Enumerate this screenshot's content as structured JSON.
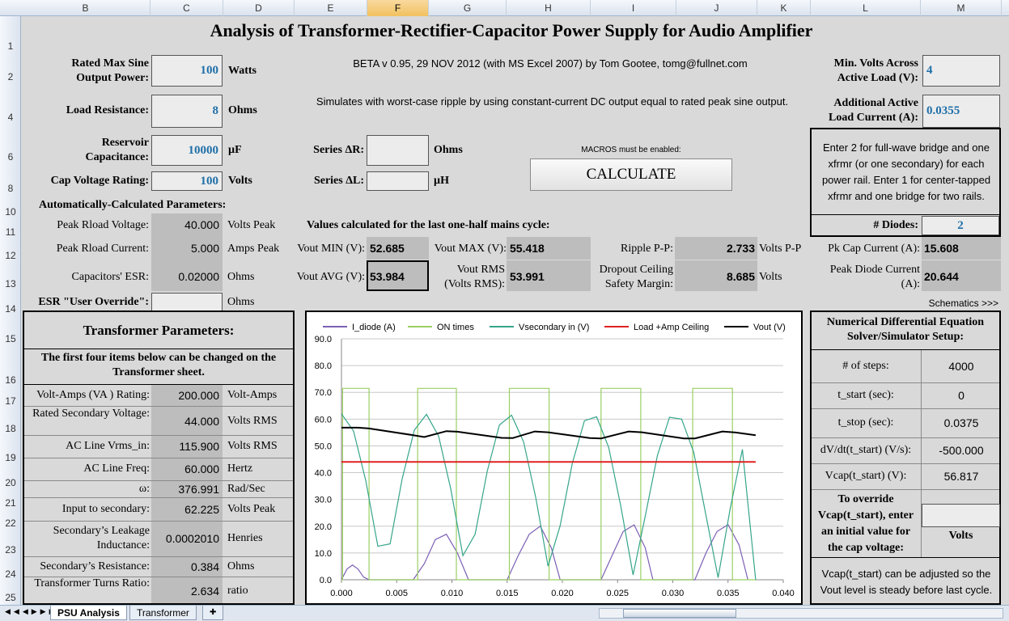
{
  "columns": [
    "B",
    "C",
    "D",
    "E",
    "F",
    "G",
    "H",
    "I",
    "J",
    "K",
    "L",
    "M"
  ],
  "selected_column": "F",
  "rows": [
    "1",
    "2",
    "4",
    "6",
    "8",
    "10",
    "11",
    "12",
    "13",
    "14",
    "15",
    "16",
    "17",
    "18",
    "19",
    "20",
    "21",
    "22",
    "23",
    "24",
    "25"
  ],
  "title": "Analysis of Transformer-Rectifier-Capacitor Power Supply for Audio Amplifier",
  "subtitle_beta": "BETA v 0.95, 29 NOV 2012 (with MS Excel 2007) by Tom Gootee, tomg@fullnet.com",
  "subtitle_sim": "Simulates with worst-case ripple by using constant-current DC output equal to rated peak sine output.",
  "inputs": {
    "rated_power": {
      "label1": "Rated Max Sine",
      "label2": "Output Power:",
      "value": "100",
      "unit": "Watts"
    },
    "load_res": {
      "label": "Load Resistance:",
      "value": "8",
      "unit": "Ohms"
    },
    "reservoir": {
      "label1": "Reservoir",
      "label2": "Capacitance:",
      "value": "10000",
      "unit": "µF"
    },
    "cap_rating": {
      "label": "Cap Voltage Rating:",
      "value": "100",
      "unit": "Volts"
    },
    "series_r": {
      "label": "Series ΔR:",
      "value": "",
      "unit": "Ohms"
    },
    "series_l": {
      "label": "Series ΔL:",
      "value": "",
      "unit": "µH"
    },
    "min_volts": {
      "label1": "Min. Volts Across",
      "label2": "Active Load (V):",
      "value": "4"
    },
    "add_current": {
      "label1": "Additional Active",
      "label2": "Load Current  (A):",
      "value": "0.0355"
    },
    "esr_override": {
      "label": "ESR \"User Override\":",
      "value": "",
      "unit": "Ohms"
    }
  },
  "macros_note": "MACROS must be enabled:",
  "calculate_label": "CALCULATE",
  "info_text": "Enter 2 for full-wave bridge and one xfrmr (or one secondary) for each power rail. Enter 1 for center-tapped xfrmr and one bridge for two rails.",
  "diodes": {
    "label": "# Diodes:",
    "value": "2"
  },
  "auto_params": {
    "heading": "Automatically-Calculated Parameters:",
    "peak_v": {
      "label": "Peak Rload Voltage:",
      "value": "40.000",
      "unit": "Volts Peak"
    },
    "peak_i": {
      "label": "Peak Rload Current:",
      "value": "5.000",
      "unit": "Amps Peak"
    },
    "esr": {
      "label": "Capacitors' ESR:",
      "value": "0.02000",
      "unit": "Ohms"
    }
  },
  "last_cycle": {
    "heading": "Values calculated for the last one-half mains cycle:",
    "vout_min": {
      "label": "Vout MIN (V):",
      "value": "52.685"
    },
    "vout_max": {
      "label": "Vout MAX (V):",
      "value": "55.418"
    },
    "ripple": {
      "label": "Ripple P-P:",
      "value": "2.733",
      "unit": "Volts P-P"
    },
    "vout_avg": {
      "label": "Vout AVG (V):",
      "value": "53.984"
    },
    "vout_rms": {
      "label1": "Vout RMS",
      "label2": "(Volts RMS):",
      "value": "53.991"
    },
    "dropout": {
      "label1": "Dropout Ceiling",
      "label2": "Safety Margin:",
      "value": "8.685",
      "unit": "Volts"
    },
    "pk_cap": {
      "label": "Pk Cap Current (A):",
      "value": "15.608"
    },
    "pk_diode": {
      "label1": "Peak Diode Current",
      "label2": "(A):",
      "value": "20.644"
    }
  },
  "schematics_link": "Schematics >>>",
  "transformer": {
    "heading": "Transformer Parameters:",
    "note": "The first four items below can be changed  on the Transformer sheet.",
    "rows": [
      {
        "label": "Volt-Amps (VA ) Rating:",
        "value": "200.000",
        "unit": "Volt-Amps"
      },
      {
        "label": "Rated Secondary Voltage:",
        "value": "44.000",
        "unit": "Volts RMS"
      },
      {
        "label": "AC Line Vrms_in:",
        "value": "115.900",
        "unit": "Volts RMS"
      },
      {
        "label": "AC Line Freq:",
        "value": "60.000",
        "unit": "Hertz"
      },
      {
        "label": "ω:",
        "value": "376.991",
        "unit": "Rad/Sec"
      },
      {
        "label": "Input to secondary:",
        "value": "62.225",
        "unit": "Volts Peak"
      },
      {
        "label": "Secondary’s Leakage Inductance:",
        "value": "0.0002010",
        "unit": "Henries"
      },
      {
        "label": "Secondary’s Resistance:",
        "value": "0.384",
        "unit": "Ohms"
      },
      {
        "label": "Transformer Turns Ratio:",
        "value": "2.634",
        "unit": "ratio"
      }
    ]
  },
  "solver": {
    "heading": "Numerical Differential Equation Solver/Simulator Setup:",
    "rows": [
      {
        "label": "# of steps:",
        "value": "4000"
      },
      {
        "label": "t_start (sec):",
        "value": "0"
      },
      {
        "label": "t_stop (sec):",
        "value": "0.0375"
      },
      {
        "label": "dV/dt(t_start) (V/s):",
        "value": "-500.000"
      },
      {
        "label": "Vcap(t_start) (V):",
        "value": "56.817"
      }
    ],
    "override_label": "To override Vcap(t_start), enter an initial value for the cap voltage:",
    "override_unit": "Volts",
    "note": "Vcap(t_start) can be adjusted so the Vout level is steady before last cycle."
  },
  "sheet_tabs": [
    "PSU Analysis",
    "Transformer"
  ],
  "chart_data": {
    "type": "line",
    "xlim": [
      0,
      0.04
    ],
    "ylim": [
      0,
      90
    ],
    "xticks": [
      "0.000",
      "0.005",
      "0.010",
      "0.015",
      "0.020",
      "0.025",
      "0.030",
      "0.035",
      "0.040"
    ],
    "yticks": [
      "0.0",
      "10.0",
      "20.0",
      "30.0",
      "40.0",
      "50.0",
      "60.0",
      "70.0",
      "80.0",
      "90.0"
    ],
    "grid": true,
    "legend_position": "top",
    "series": [
      {
        "name": "I_diode (A)",
        "color": "#7b5fb5",
        "x": [
          0,
          0.0005,
          0.001,
          0.0015,
          0.002,
          0.0025,
          0.0065,
          0.0075,
          0.0085,
          0.0095,
          0.0105,
          0.0115,
          0.015,
          0.016,
          0.017,
          0.018,
          0.019,
          0.0198,
          0.0235,
          0.0245,
          0.0255,
          0.0265,
          0.0275,
          0.0282,
          0.032,
          0.033,
          0.034,
          0.035,
          0.036,
          0.0368
        ],
        "y": [
          0,
          4,
          5.5,
          4,
          1,
          0,
          0,
          6,
          15,
          17,
          10,
          0,
          0,
          9,
          17,
          20,
          12,
          0,
          0,
          9,
          18,
          20.5,
          12,
          0,
          0,
          10,
          18,
          20.6,
          13,
          0
        ]
      },
      {
        "name": "ON times",
        "color": "#9bcf63",
        "x": [
          0,
          0.0001,
          0.0001,
          0.0025,
          0.0025,
          0.0069,
          0.0069,
          0.0104,
          0.0104,
          0.0152,
          0.0152,
          0.0188,
          0.0188,
          0.0235,
          0.0235,
          0.0271,
          0.0271,
          0.0318,
          0.0318,
          0.0354,
          0.0354,
          0.0375
        ],
        "y": [
          0,
          0,
          71.5,
          71.5,
          0,
          0,
          71.5,
          71.5,
          0,
          0,
          71.5,
          71.5,
          0,
          0,
          71.5,
          71.5,
          0,
          0,
          71.5,
          71.5,
          0,
          0
        ]
      },
      {
        "name": "Vsecondary in (V)",
        "color": "#35a58a",
        "x": [
          0,
          0.0011,
          0.0022,
          0.0033,
          0.0044,
          0.0055,
          0.0066,
          0.0077,
          0.0088,
          0.0099,
          0.011,
          0.0121,
          0.0132,
          0.0143,
          0.0154,
          0.0165,
          0.0176,
          0.0187,
          0.0198,
          0.0209,
          0.022,
          0.0231,
          0.0242,
          0.0253,
          0.0264,
          0.0275,
          0.0286,
          0.0297,
          0.0308,
          0.0319,
          0.033,
          0.0341,
          0.0352,
          0.0363,
          0.0375
        ],
        "y": [
          62,
          55.5,
          37.1,
          12.5,
          13.4,
          37.8,
          55.9,
          61.8,
          53.6,
          33.9,
          9,
          17,
          40.6,
          57.8,
          61.5,
          51.4,
          30.6,
          5.1,
          20.2,
          43.5,
          59.4,
          60.9,
          49.4,
          27.4,
          1.8,
          23.7,
          46.3,
          60.7,
          60,
          47.6,
          24,
          0.8,
          26.7,
          48.7,
          0
        ]
      },
      {
        "name": "Load +Amp Ceiling",
        "color": "#e02020",
        "x": [
          0,
          0.0375
        ],
        "y": [
          44,
          44
        ]
      },
      {
        "name": "Vout (V)",
        "color": "#000000",
        "x": [
          0,
          0.0015,
          0.0025,
          0.0065,
          0.0075,
          0.0095,
          0.0105,
          0.0145,
          0.0155,
          0.0175,
          0.0187,
          0.0225,
          0.0235,
          0.026,
          0.0272,
          0.031,
          0.032,
          0.0345,
          0.0357,
          0.0375
        ],
        "y": [
          56.8,
          56.8,
          56.5,
          54,
          53.3,
          55.5,
          55.3,
          53,
          52.9,
          55.4,
          55.1,
          52.9,
          52.8,
          55.4,
          55.1,
          52.8,
          52.8,
          55.4,
          55,
          54
        ]
      }
    ]
  }
}
